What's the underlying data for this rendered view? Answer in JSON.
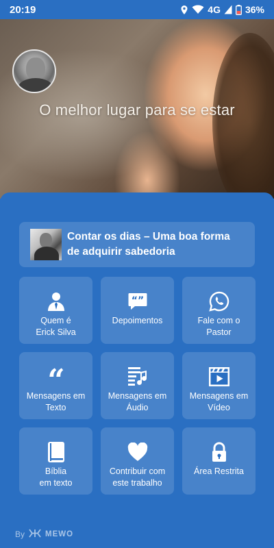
{
  "status_bar": {
    "time": "20:19",
    "network": "4G",
    "battery": "36%"
  },
  "hero": {
    "title": "O melhor lugar para se estar"
  },
  "featured": {
    "title": "Contar os dias – Uma boa forma de adquirir sabedoria"
  },
  "tiles": [
    {
      "label": "Quem é\nErick Silva",
      "icon": "person-icon"
    },
    {
      "label": "Depoimentos",
      "icon": "quote-bubble-icon"
    },
    {
      "label": "Fale com o\nPastor",
      "icon": "whatsapp-icon"
    },
    {
      "label": "Mensagens em\nTexto",
      "icon": "quote-icon"
    },
    {
      "label": "Mensagens em\nÁudio",
      "icon": "music-list-icon"
    },
    {
      "label": "Mensagens em\nVídeo",
      "icon": "film-icon"
    },
    {
      "label": "Bíblia\nem texto",
      "icon": "book-icon"
    },
    {
      "label": "Contribuir com\neste trabalho",
      "icon": "heart-icon"
    },
    {
      "label": "Área Restrita",
      "icon": "lock-icon"
    }
  ],
  "footer": {
    "by": "By",
    "brand": "MEWO"
  }
}
